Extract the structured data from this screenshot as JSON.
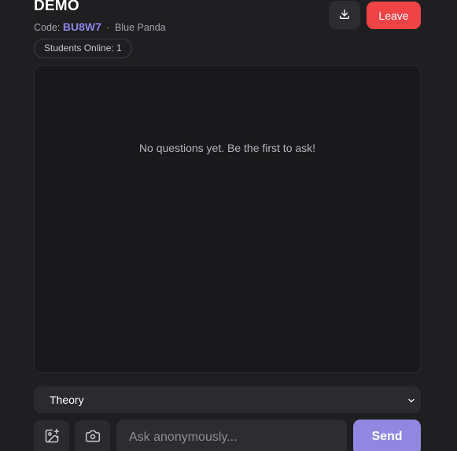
{
  "room": {
    "title": "DEMO",
    "code_label": "Code:",
    "code": "BU8W7",
    "separator": "·",
    "alias": "Blue Panda",
    "online": "Students Online: 1"
  },
  "header": {
    "download_icon": "download-icon",
    "leave_label": "Leave",
    "leave_color": "#ef4346"
  },
  "questions": {
    "empty_message": "No questions yet. Be the first to ask!"
  },
  "composer": {
    "category": "Theory",
    "image_icon": "image-plus-icon",
    "camera_icon": "camera-icon",
    "placeholder": "Ask anonymously...",
    "send_label": "Send",
    "accent_color": "#9186e0"
  }
}
